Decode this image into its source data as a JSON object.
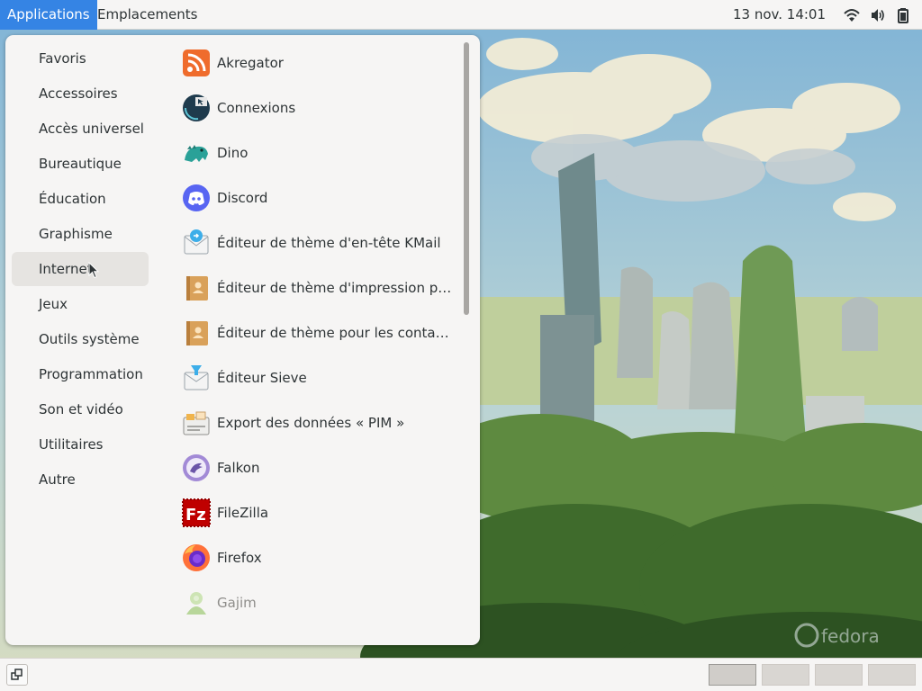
{
  "topbar": {
    "applications_label": "Applications",
    "places_label": "Emplacements",
    "clock": "13 nov.  14:01",
    "tray_icons": [
      "wifi-icon",
      "volume-icon",
      "battery-icon"
    ]
  },
  "menu": {
    "categories": [
      {
        "label": "Favoris"
      },
      {
        "label": "Accessoires"
      },
      {
        "label": "Accès universel"
      },
      {
        "label": "Bureautique"
      },
      {
        "label": "Éducation"
      },
      {
        "label": "Graphisme"
      },
      {
        "label": "Internet",
        "hovered": true
      },
      {
        "label": "Jeux"
      },
      {
        "label": "Outils système"
      },
      {
        "label": "Programmation"
      },
      {
        "label": "Son et vidéo"
      },
      {
        "label": "Utilitaires"
      },
      {
        "label": "Autre"
      }
    ],
    "apps": [
      {
        "label": "Akregator",
        "icon": "rss-feed-icon"
      },
      {
        "label": "Connexions",
        "icon": "remote-desktop-icon"
      },
      {
        "label": "Dino",
        "icon": "dino-icon"
      },
      {
        "label": "Discord",
        "icon": "discord-icon"
      },
      {
        "label": "Éditeur de thème d'en-tête KMail",
        "icon": "mail-theme-icon"
      },
      {
        "label": "Éditeur de thème d'impression pour...",
        "icon": "contact-theme-icon"
      },
      {
        "label": "Éditeur de thème pour les contacts",
        "icon": "contact-theme-icon"
      },
      {
        "label": "Éditeur Sieve",
        "icon": "mail-filter-icon"
      },
      {
        "label": "Export des données « PIM »",
        "icon": "pim-export-icon"
      },
      {
        "label": "Falkon",
        "icon": "falkon-icon"
      },
      {
        "label": "FileZilla",
        "icon": "filezilla-icon"
      },
      {
        "label": "Firefox",
        "icon": "firefox-icon"
      },
      {
        "label": "Gajim",
        "icon": "gajim-icon",
        "dimmed": true
      }
    ]
  },
  "colors": {
    "accent": "#3584e4",
    "panel_bg": "#f6f5f4",
    "menu_hover": "#e6e4e1"
  },
  "wallpaper": {
    "watermark": "fedora"
  }
}
